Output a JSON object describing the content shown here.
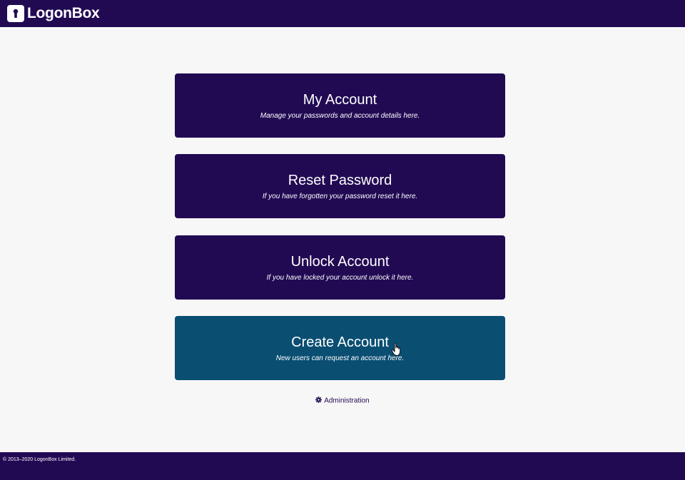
{
  "header": {
    "brand": "LogonBox",
    "logo_icon": "keyhole-icon"
  },
  "cards": [
    {
      "title": "My Account",
      "description": "Manage your passwords and account details here."
    },
    {
      "title": "Reset Password",
      "description": "If you have forgotten your password reset it here."
    },
    {
      "title": "Unlock Account",
      "description": "If you have locked your account unlock it here."
    },
    {
      "title": "Create Account",
      "description": "New users can request an account here."
    }
  ],
  "admin": {
    "label": "Administration",
    "icon": "gear-icon"
  },
  "footer": {
    "copyright": "© 2013–2020 LogonBox Limited."
  },
  "colors": {
    "primary": "#220a53",
    "hover": "#0a4e72",
    "background": "#f7f7f7"
  }
}
